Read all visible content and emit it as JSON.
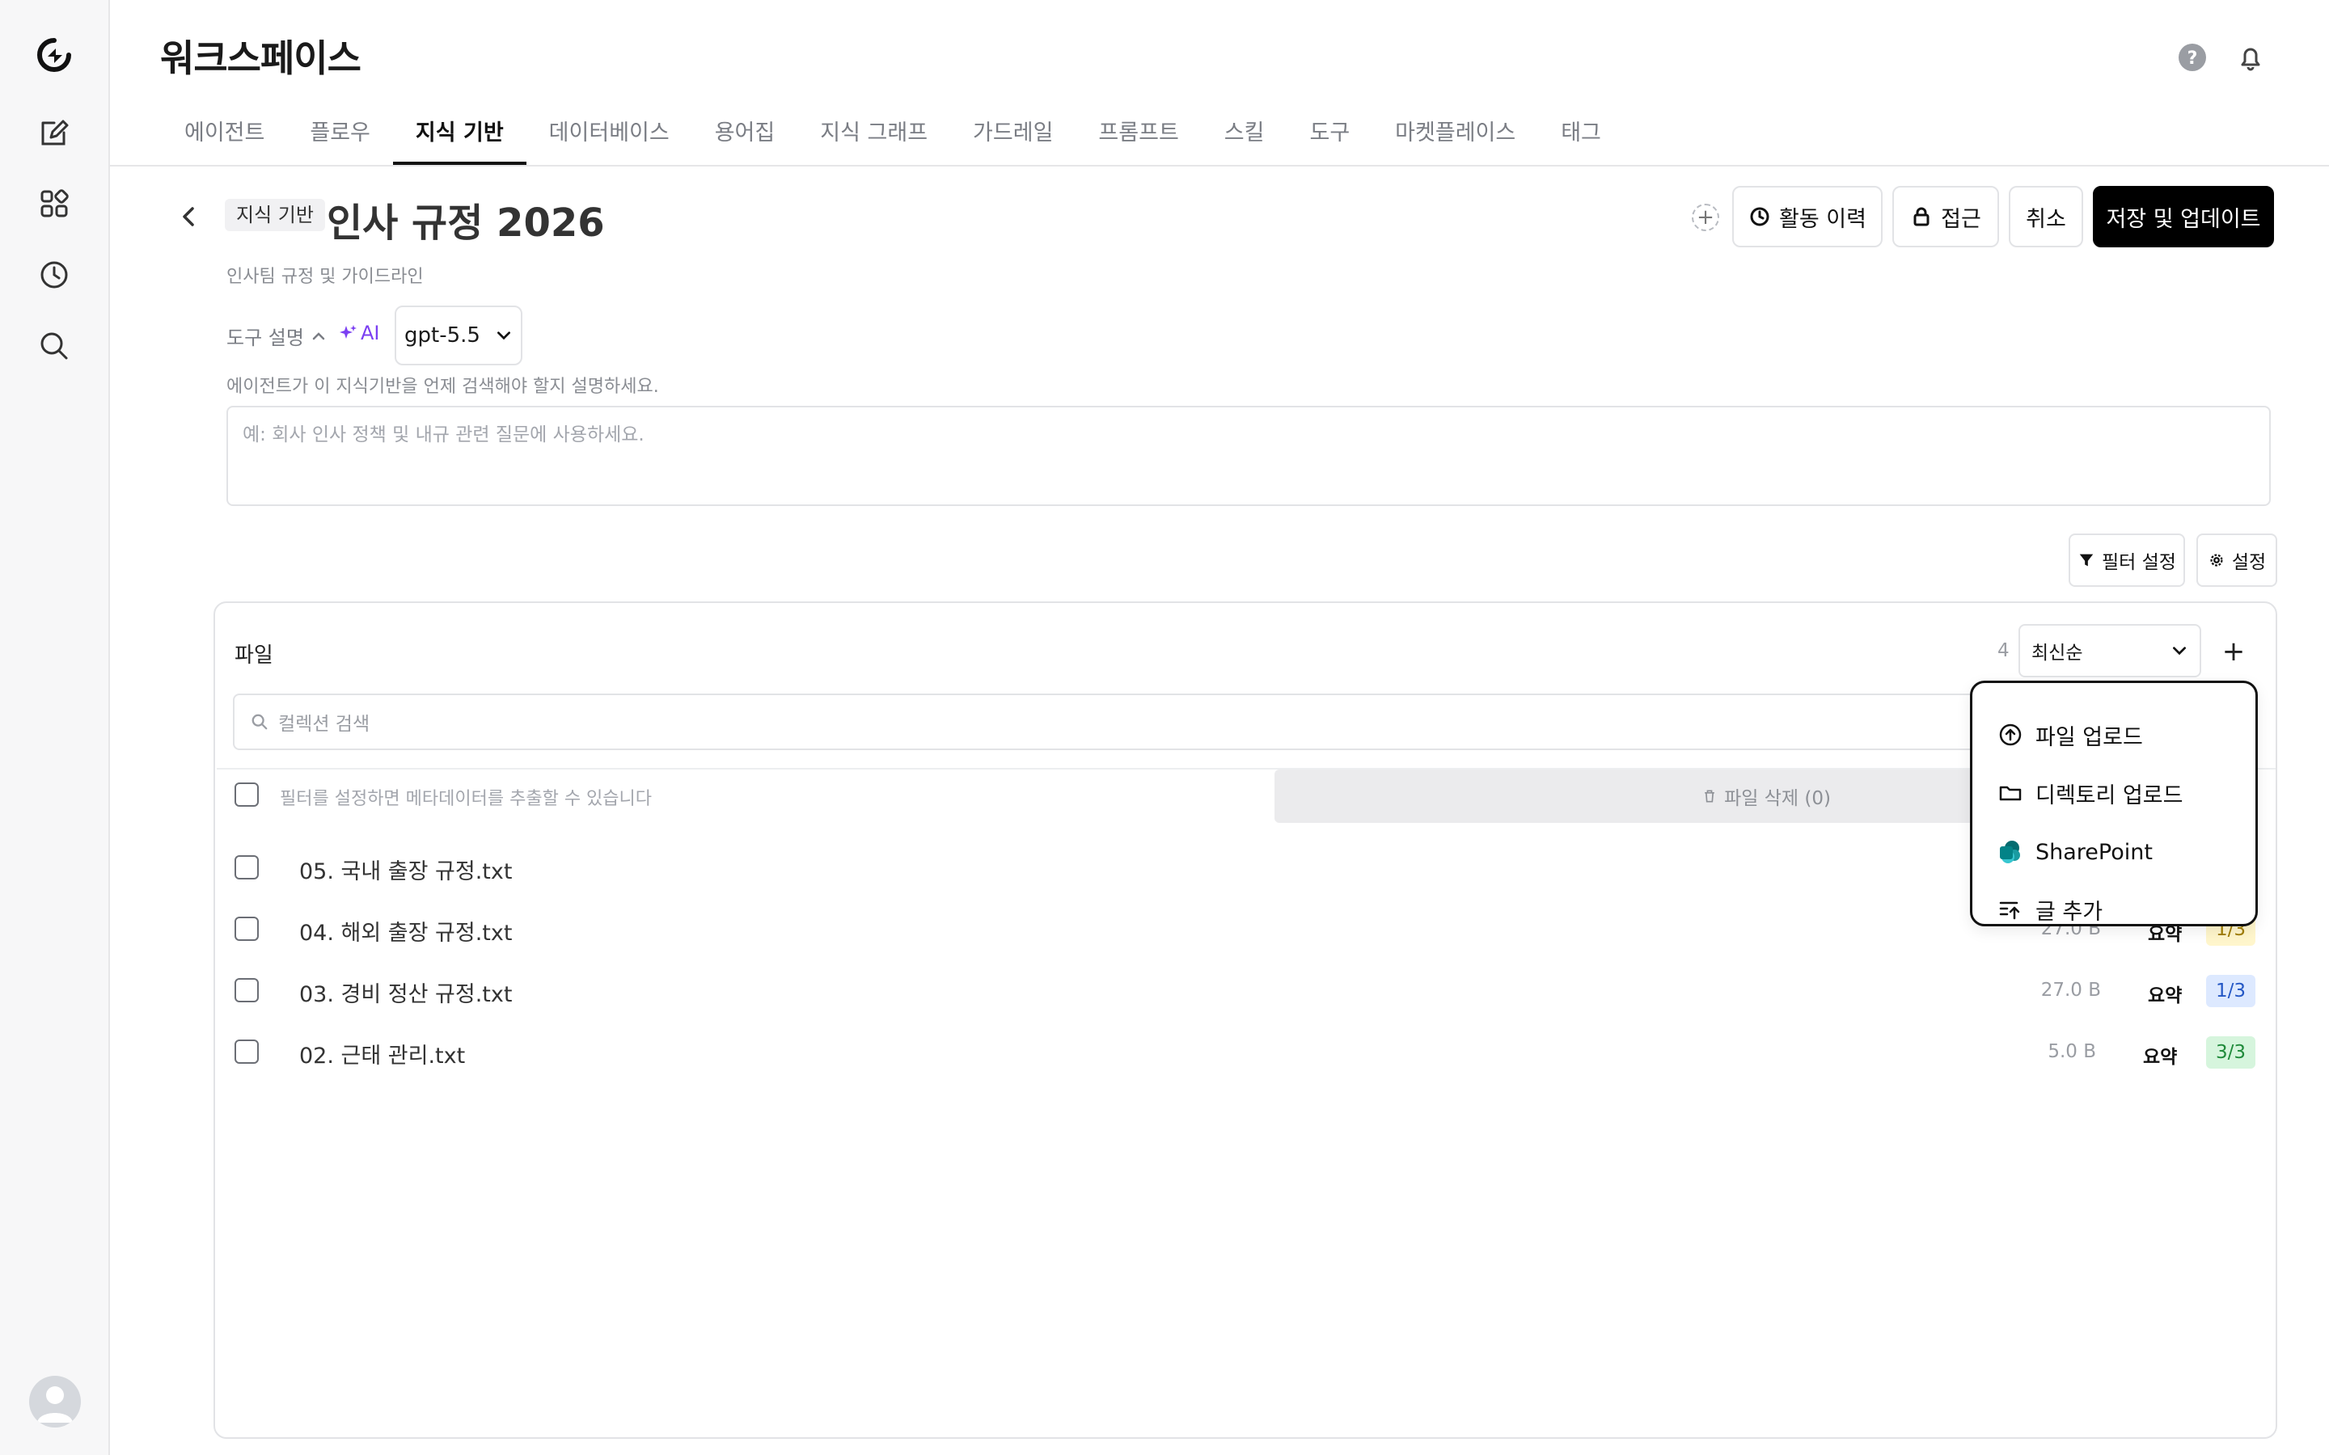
{
  "app": {
    "title": "워크스페이스"
  },
  "tabs": [
    "에이전트",
    "플로우",
    "지식 기반",
    "데이터베이스",
    "용어집",
    "지식 그래프",
    "가드레일",
    "프롬프트",
    "스킬",
    "도구",
    "마켓플레이스",
    "태그"
  ],
  "active_tab": "지식 기반",
  "page": {
    "chip": "지식 기반",
    "title": "인사 규정 2026",
    "subtitle": "인사팀 규정 및 가이드라인"
  },
  "actions": {
    "history": "활동 이력",
    "access": "접근",
    "cancel": "취소",
    "save": "저장 및 업데이트"
  },
  "tool": {
    "label": "도구 설명",
    "ai": "AI",
    "model": "gpt-5.5",
    "hint": "에이전트가 이 지식기반을 언제 검색해야 할지 설명하세요.",
    "placeholder": "예: 회사 인사 정책 및 내규 관련 질문에 사용하세요."
  },
  "toolbar": {
    "filter": "필터 설정",
    "settings": "설정"
  },
  "files": {
    "title": "파일",
    "count": "4",
    "sort": "최신순",
    "search_placeholder": "컬렉션 검색",
    "meta_hint": "필터를 설정하면 메타데이터를 추출할 수 있습니다",
    "delete_label": "파일 삭제 (0)",
    "rows": [
      {
        "name": "05. 국내 출장 규정.txt",
        "size": "",
        "summary": "",
        "badge": ""
      },
      {
        "name": "04. 해외 출장 규정.txt",
        "size": "27.0 B",
        "summary": "요약",
        "badge": "1/3"
      },
      {
        "name": "03. 경비 정산 규정.txt",
        "size": "27.0 B",
        "summary": "요약",
        "badge": "1/3"
      },
      {
        "name": "02. 근태 관리.txt",
        "size": "5.0 B",
        "summary": "요약",
        "badge": "3/3"
      }
    ]
  },
  "menu": {
    "items": [
      {
        "label": "파일 업로드",
        "icon": "upload-circle-icon"
      },
      {
        "label": "디렉토리 업로드",
        "icon": "folder-icon"
      },
      {
        "label": "SharePoint",
        "icon": "sharepoint-icon"
      },
      {
        "label": "글 추가",
        "icon": "add-text-icon"
      }
    ]
  },
  "colors": {
    "accent": "#000000",
    "ai": "#7b3ff2",
    "border": "#e2e3e6"
  }
}
